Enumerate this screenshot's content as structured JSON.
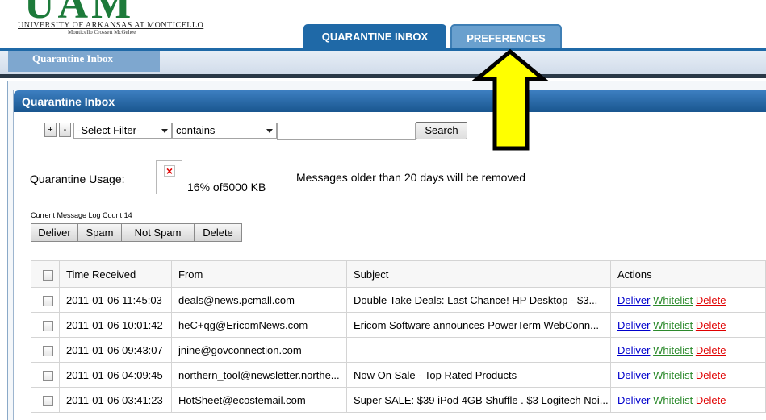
{
  "header": {
    "logo_letters": "UAM",
    "logo_line1": "UNIVERSITY OF ARKANSAS AT MONTICELLO",
    "logo_line2": "Monticello  Crossett  McGehee",
    "tabs": [
      {
        "label": "QUARANTINE INBOX",
        "active": true
      },
      {
        "label": "PREFERENCES",
        "active": false
      }
    ]
  },
  "nav": {
    "subtab": "Quarantine Inbox"
  },
  "panel": {
    "title": "Quarantine Inbox"
  },
  "filter": {
    "plus": "+",
    "minus": "-",
    "field_select": "-Select Filter-",
    "operator_select": "contains",
    "search_value": "",
    "search_button": "Search"
  },
  "usage": {
    "label": "Quarantine Usage:",
    "percent_text": "16% of5000 KB",
    "percent": 16,
    "note": "Messages older than 20 days will be removed"
  },
  "log_count": "Current Message Log Count:14",
  "actions": [
    "Deliver",
    "Spam",
    "Not Spam",
    "Delete"
  ],
  "table": {
    "headers": [
      "Time Received",
      "From",
      "Subject",
      "Actions"
    ],
    "row_actions": {
      "deliver": "Deliver",
      "whitelist": "Whitelist",
      "delete": "Delete"
    },
    "rows": [
      {
        "time": "2011-01-06 11:45:03",
        "from": "deals@news.pcmall.com",
        "subject": "Double Take Deals: Last Chance! HP Desktop - $3..."
      },
      {
        "time": "2011-01-06 10:01:42",
        "from": "heC+qg@EricomNews.com",
        "subject": "Ericom Software announces PowerTerm WebConn..."
      },
      {
        "time": "2011-01-06 09:43:07",
        "from": "jnine@govconnection.com",
        "subject": ""
      },
      {
        "time": "2011-01-06 04:09:45",
        "from": "northern_tool@newsletter.northe...",
        "subject": "Now On Sale - Top Rated Products"
      },
      {
        "time": "2011-01-06 03:41:23",
        "from": "HotSheet@ecostemail.com",
        "subject": "Super SALE: $39 iPod 4GB Shuffle . $3 Logitech Noi..."
      }
    ]
  },
  "colors": {
    "tab_active": "#1f69a7",
    "tab_inactive": "#6aa0ce",
    "arrow_fill": "#ffff00",
    "deliver_link": "#0000cc",
    "whitelist_link": "#2c8a2c",
    "delete_link": "#e00000"
  }
}
